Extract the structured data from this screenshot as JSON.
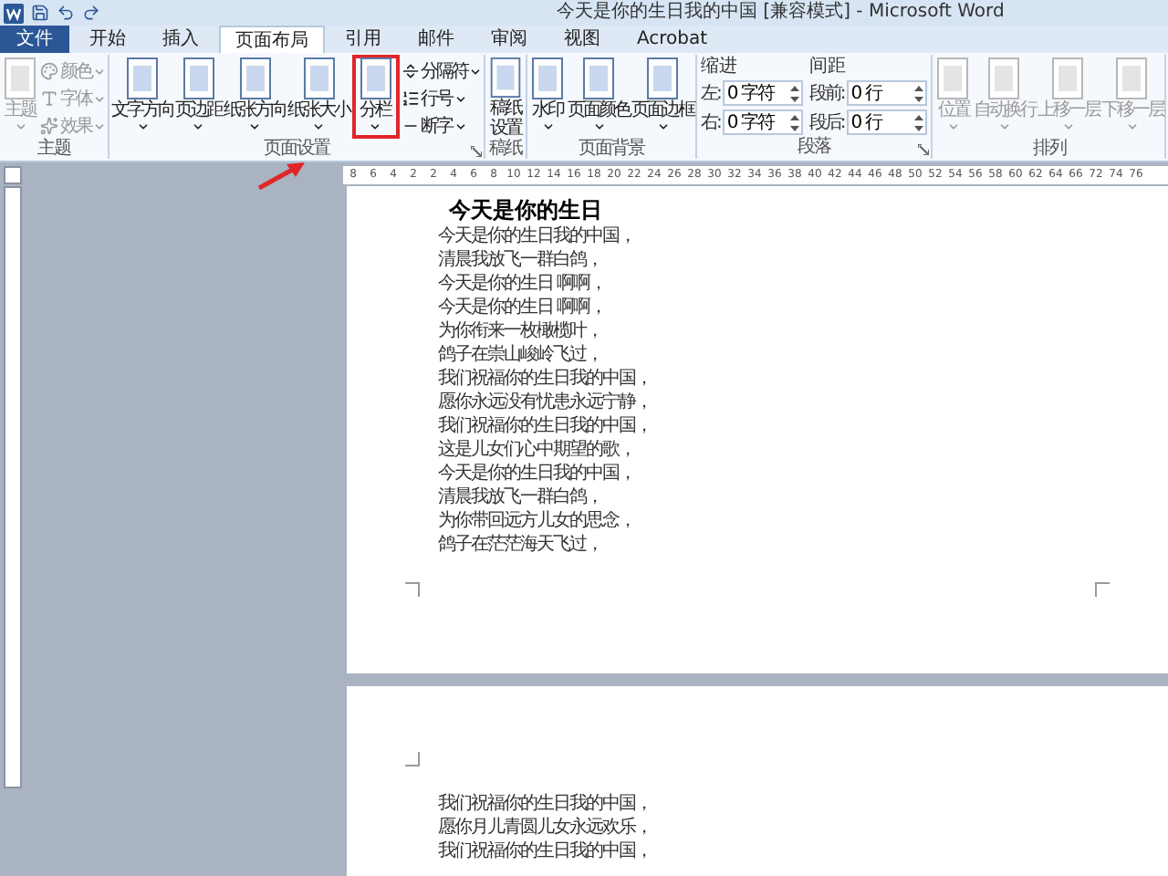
{
  "window": {
    "title": "今天是你的生日我的中国 [兼容模式] - Microsoft Word"
  },
  "tabs": [
    {
      "label": "文件",
      "kind": "file",
      "selected": false
    },
    {
      "label": "开始",
      "kind": "tab",
      "selected": false
    },
    {
      "label": "插入",
      "kind": "tab",
      "selected": false
    },
    {
      "label": "页面布局",
      "kind": "tab",
      "selected": true
    },
    {
      "label": "引用",
      "kind": "tab",
      "selected": false
    },
    {
      "label": "邮件",
      "kind": "tab",
      "selected": false
    },
    {
      "label": "审阅",
      "kind": "tab",
      "selected": false
    },
    {
      "label": "视图",
      "kind": "tab",
      "selected": false
    },
    {
      "label": "Acrobat",
      "kind": "tab",
      "selected": false
    }
  ],
  "ribbon": {
    "groups": [
      {
        "label": "主题",
        "kind": "buttons",
        "dialog_launcher": false,
        "items": [
          {
            "kind": "large",
            "label": "主题",
            "disabled": true,
            "highlighted": false
          },
          {
            "kind": "stack",
            "disabled": true,
            "highlighted": false,
            "entries": [
              "颜色",
              "字体",
              "效果"
            ]
          }
        ]
      },
      {
        "label": "页面设置",
        "kind": "buttons",
        "dialog_launcher": true,
        "items": [
          {
            "kind": "large",
            "label": "文字方向",
            "disabled": false,
            "highlighted": false
          },
          {
            "kind": "large",
            "label": "页边距",
            "disabled": false,
            "highlighted": false
          },
          {
            "kind": "large",
            "label": "纸张方向",
            "disabled": false,
            "highlighted": false
          },
          {
            "kind": "large",
            "label": "纸张大小",
            "disabled": false,
            "highlighted": false
          },
          {
            "kind": "large",
            "label": "分栏",
            "disabled": false,
            "highlighted": true
          },
          {
            "kind": "stack",
            "disabled": false,
            "highlighted": false,
            "entries": [
              "分隔符",
              "行号",
              "断字"
            ]
          }
        ]
      },
      {
        "label": "稿纸",
        "kind": "buttons",
        "dialog_launcher": false,
        "items": [
          {
            "kind": "wrapped",
            "label": "稿纸设置",
            "disabled": false,
            "highlighted": false
          }
        ]
      },
      {
        "label": "页面背景",
        "kind": "buttons",
        "dialog_launcher": false,
        "items": [
          {
            "kind": "large",
            "label": "水印",
            "disabled": false,
            "highlighted": false
          },
          {
            "kind": "large",
            "label": "页面颜色",
            "disabled": false,
            "highlighted": false
          },
          {
            "kind": "large",
            "label": "页面边框",
            "disabled": false,
            "highlighted": false
          }
        ]
      },
      {
        "label": "段落",
        "kind": "paragraph",
        "dialog_launcher": true,
        "sections": [
          {
            "label": "缩进",
            "fields": [
              {
                "label": "左:",
                "value": "0 字符"
              },
              {
                "label": "右:",
                "value": "0 字符"
              }
            ]
          },
          {
            "label": "间距",
            "fields": [
              {
                "label": "段前:",
                "value": "0 行"
              },
              {
                "label": "段后:",
                "value": "0 行"
              }
            ]
          }
        ]
      },
      {
        "label": "排列",
        "kind": "buttons",
        "dialog_launcher": false,
        "items": [
          {
            "kind": "large",
            "label": "位置",
            "disabled": true,
            "highlighted": false
          },
          {
            "kind": "large",
            "label": "自动换行",
            "disabled": true,
            "highlighted": false
          },
          {
            "kind": "large",
            "label": "上移一层",
            "disabled": true,
            "highlighted": false
          },
          {
            "kind": "large",
            "label": "下移一层",
            "disabled": true,
            "highlighted": false
          }
        ]
      }
    ]
  },
  "ruler": {
    "labels": [
      "8",
      "6",
      "4",
      "2",
      "2",
      "4",
      "6",
      "8",
      "10",
      "12",
      "14",
      "16",
      "18",
      "20",
      "22",
      "24",
      "26",
      "28",
      "30",
      "32",
      "34",
      "36",
      "38",
      "40",
      "42",
      "44",
      "46",
      "48",
      "50",
      "52",
      "54",
      "56",
      "58",
      "60",
      "62",
      "64",
      "66",
      "72",
      "74",
      "76"
    ]
  },
  "pages": [
    {
      "heading": "今天是你的生日",
      "lines": [
        "今天是你的生日我的中国，",
        "清晨我放飞一群白鸽，",
        "今天是你的生日 啊啊，",
        "今天是你的生日 啊啊，",
        "为你衔来一枚橄榄叶，",
        "鸽子在崇山峻岭飞过，",
        "我们祝福你的生日我的中国，",
        "愿你永远没有忧患永远宁静，",
        "我们祝福你的生日我的中国，",
        "这是儿女们心中期望的歌，",
        "今天是你的生日我的中国，",
        "清晨我放飞一群白鸽，",
        "为你带回远方儿女的思念，",
        "鸽子在茫茫海天飞过，"
      ]
    },
    {
      "lines": [
        "我们祝福你的生日我的中国，",
        "愿你月儿青圆儿女永远欢乐，",
        "我们祝福你的生日我的中国，"
      ]
    }
  ]
}
